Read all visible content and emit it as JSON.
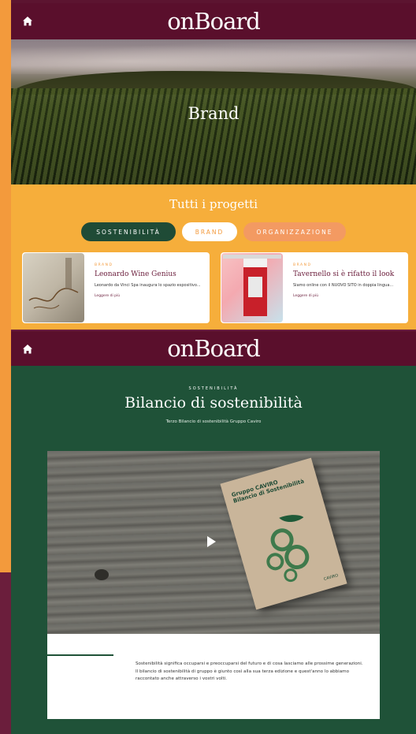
{
  "colors": {
    "burgundy": "#5a0f2c",
    "orange": "#f6ae3b",
    "green": "#1f5238",
    "accent": "#f39a3c"
  },
  "screen1": {
    "header": {
      "logo": "onBoard",
      "home_icon": "home-icon"
    },
    "hero": {
      "title": "Brand"
    },
    "section_title": "Tutti i progetti",
    "filters": [
      {
        "label": "SOSTENIBILITÀ",
        "state": "active"
      },
      {
        "label": "BRAND",
        "state": "selected"
      },
      {
        "label": "ORGANIZZAZIONE",
        "state": "inactive"
      }
    ],
    "cards": [
      {
        "tag": "BRAND",
        "title": "Leonardo Wine Genius",
        "text": "Leonardo da Vinci Spa inaugura lo spazio espositivo...",
        "link": "Leggere di più"
      },
      {
        "tag": "BRAND",
        "title": "Tavernello si è rifatto il look",
        "text": "Siamo online con il NUOVO SITO in doppia lingua...",
        "link": "Leggere di più"
      }
    ]
  },
  "screen2": {
    "header": {
      "logo": "onBoard",
      "home_icon": "home-icon"
    },
    "kicker": "SOSTENIBILITÀ",
    "title": "Bilancio di sostenibilità",
    "subtitle": "Terzo Bilancio di sostenibilità Gruppo Caviro",
    "book": {
      "title_line1": "Gruppo CAVIRO",
      "title_line2": "Bilancio di Sostenibilità",
      "logo": "CAVIRO"
    },
    "body": {
      "p1": "Sostenibilità significa occuparsi e preoccuparsi del futuro e di cosa lasciamo alle prossime generazioni.",
      "p2": "Il bilancio di sostenibilità di gruppo è giunto così alla sua terza edizione e quest'anno lo abbiamo raccontato anche attraverso i vostri volti."
    }
  }
}
